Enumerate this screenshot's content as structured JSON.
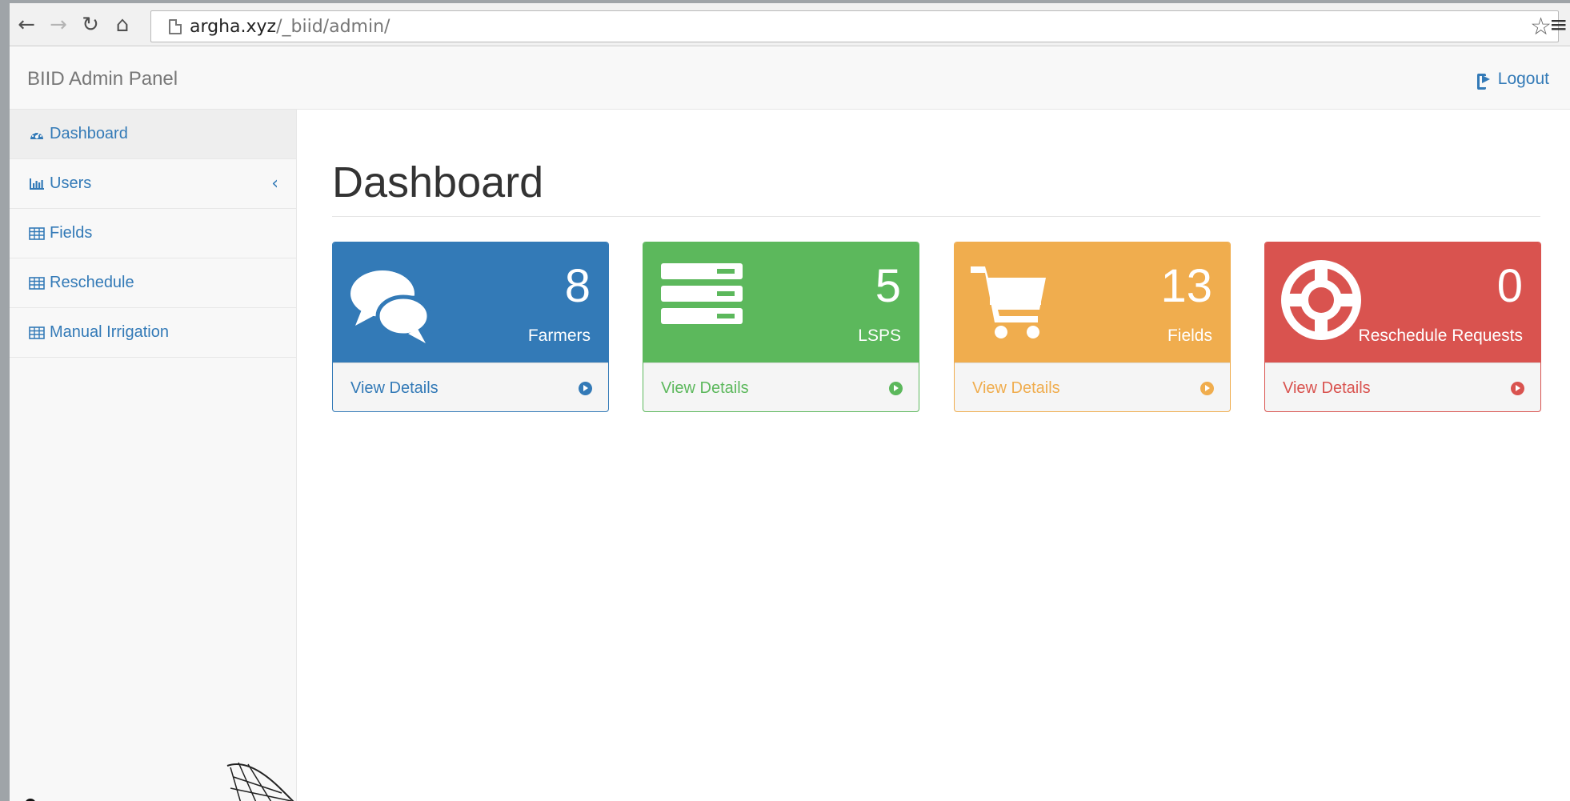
{
  "browser": {
    "url_host": "argha.xyz",
    "url_path": "/_biid/admin/"
  },
  "navbar": {
    "brand": "BIID Admin Panel",
    "logout_label": "Logout"
  },
  "sidebar": {
    "items": [
      {
        "label": "Dashboard",
        "icon": "dashboard-icon"
      },
      {
        "label": "Users",
        "icon": "bar-chart-icon"
      },
      {
        "label": "Fields",
        "icon": "table-icon"
      },
      {
        "label": "Reschedule",
        "icon": "table-icon"
      },
      {
        "label": "Manual Irrigation",
        "icon": "table-icon"
      }
    ]
  },
  "main": {
    "title": "Dashboard",
    "panels": [
      {
        "count": "8",
        "label": "Farmers",
        "footer": "View Details",
        "icon": "comments-icon",
        "color": "#337ab7"
      },
      {
        "count": "5",
        "label": "LSPS",
        "footer": "View Details",
        "icon": "server-icon",
        "color": "#5cb85c"
      },
      {
        "count": "13",
        "label": "Fields",
        "footer": "View Details",
        "icon": "shopping-cart-icon",
        "color": "#f0ad4e"
      },
      {
        "count": "0",
        "label": "Reschedule Requests",
        "footer": "View Details",
        "icon": "life-ring-icon",
        "color": "#d9534f"
      }
    ]
  }
}
